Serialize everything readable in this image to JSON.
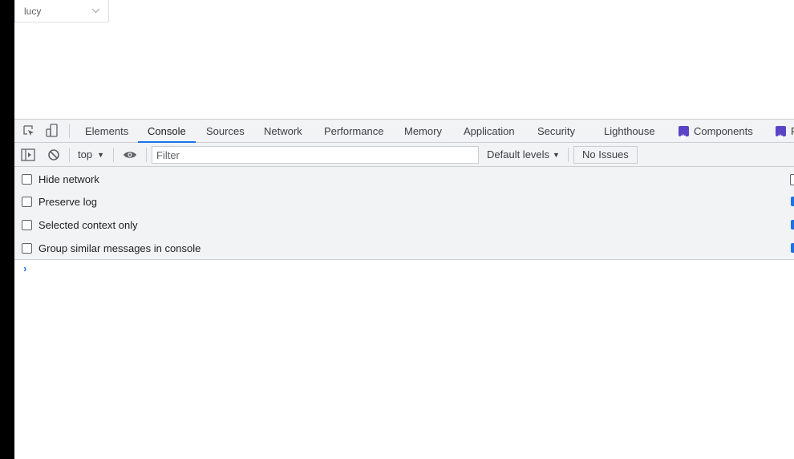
{
  "app": {
    "select": {
      "value": "lucy",
      "icon": "chevron-down-icon"
    }
  },
  "devtools": {
    "tabs": [
      {
        "label": "Elements"
      },
      {
        "label": "Console",
        "active": true
      },
      {
        "label": "Sources"
      },
      {
        "label": "Network"
      },
      {
        "label": "Performance"
      },
      {
        "label": "Memory"
      },
      {
        "label": "Application"
      },
      {
        "label": "Security"
      },
      {
        "label": "Lighthouse"
      },
      {
        "label": "Components",
        "icon": "react-components-icon"
      },
      {
        "label": "P",
        "icon": "react-profiler-icon"
      }
    ],
    "toolbar": {
      "context": "top",
      "filter_placeholder": "Filter",
      "levels": "Default levels",
      "issues": "No Issues"
    },
    "settings": [
      {
        "label": "Hide network",
        "checked": false
      },
      {
        "label": "Preserve log",
        "checked": false
      },
      {
        "label": "Selected context only",
        "checked": false
      },
      {
        "label": "Group similar messages in console",
        "checked": false
      }
    ],
    "prompt_symbol": "›",
    "colors": {
      "accent": "#1a73e8",
      "toolbar_bg": "#f1f3f4",
      "react_icon": "#5b44c6"
    }
  }
}
